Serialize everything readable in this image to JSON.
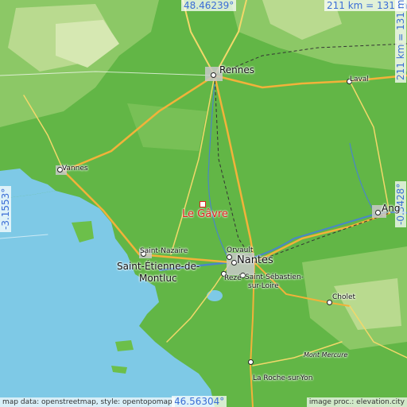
{
  "map": {
    "center_place": "Le Gâvre",
    "top_lat": "48.46239°",
    "bottom_lat": "46.56304°",
    "left_lon": "-3.1553°",
    "right_lon": "-0.3428°",
    "scale_horizontal": "211 km = 131 mi",
    "scale_vertical": "211 km = 131 mi",
    "credit_data": "map data: openstreetmap, style: opentopomap",
    "credit_image": "image proc.: elevation.city",
    "colors": {
      "land_low": "#6cbf4a",
      "land_high": "#b7d98a",
      "sea": "#7ec9e6",
      "highlight": "#e0231f",
      "coord_text": "#3b6ed6"
    }
  },
  "places": {
    "rennes": "Rennes",
    "laval": "Laval",
    "vannes": "Vannes",
    "angers": "Ang",
    "saint_nazaire": "Saint-Nazaire",
    "saint_etienne": "Saint-Étienne-de-",
    "montluc": "Montluc",
    "orvault": "Orvault",
    "nantes": "Nantes",
    "reze": "Rezé",
    "saint_sebastien_1": "Saint-Sébastien-",
    "saint_sebastien_2": "sur-Loire",
    "cholet": "Cholet",
    "mont_mercure": "Mont Mercure",
    "la_roche": "La Roche-sur-Yon"
  }
}
